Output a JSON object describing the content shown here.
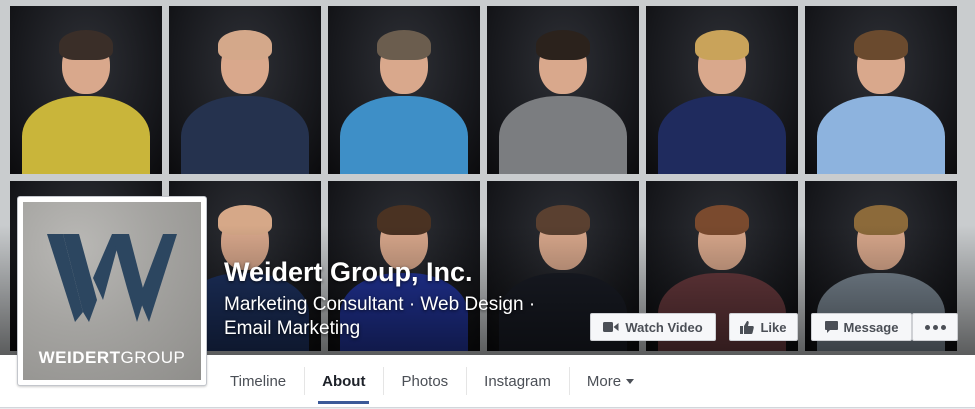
{
  "page": {
    "name": "Weidert Group, Inc.",
    "category_line1": "Marketing Consultant · Web Design ·",
    "category_line2": "Email Marketing"
  },
  "profile_picture": {
    "wordmark_bold": "WEIDERT",
    "wordmark_light": "GROUP",
    "logo_letter_icon": "w-logo-icon"
  },
  "cover_photo": {
    "people": [
      {
        "hair": "#3a2e28",
        "shirt": "#c9b53a"
      },
      {
        "hair": "#d4a88a",
        "shirt": "#25324e"
      },
      {
        "hair": "#6b5d4e",
        "shirt": "#3e8fc7"
      },
      {
        "hair": "#2b221c",
        "shirt": "#7b7d80"
      },
      {
        "hair": "#c9a35a",
        "shirt": "#1f2b5e"
      },
      {
        "hair": "#6a4a2e",
        "shirt": "#8db3de"
      },
      {
        "hair": "#1a1a1c",
        "shirt": "#1a1a1c"
      },
      {
        "hair": "#d6a888",
        "shirt": "#1e3363"
      },
      {
        "hair": "#4a3222",
        "shirt": "#2336a0"
      },
      {
        "hair": "#5a4030",
        "shirt": "#1a1d26"
      },
      {
        "hair": "#7a4a2e",
        "shirt": "#6b3b3f"
      },
      {
        "hair": "#8c6a3a",
        "shirt": "#7d8a96"
      }
    ]
  },
  "buttons": {
    "watch_video": "Watch Video",
    "like": "Like",
    "message": "Message"
  },
  "icons": {
    "video": "video-camera-icon",
    "like": "thumbs-up-icon",
    "message": "chat-bubble-icon",
    "more": "more-dots-icon"
  },
  "tabs": [
    {
      "label": "Timeline",
      "active": false
    },
    {
      "label": "About",
      "active": true
    },
    {
      "label": "Photos",
      "active": false
    },
    {
      "label": "Instagram",
      "active": false
    },
    {
      "label": "More",
      "active": false,
      "dropdown": true
    }
  ],
  "colors": {
    "accent": "#3b5998",
    "logo_blue": "#2c4660"
  }
}
